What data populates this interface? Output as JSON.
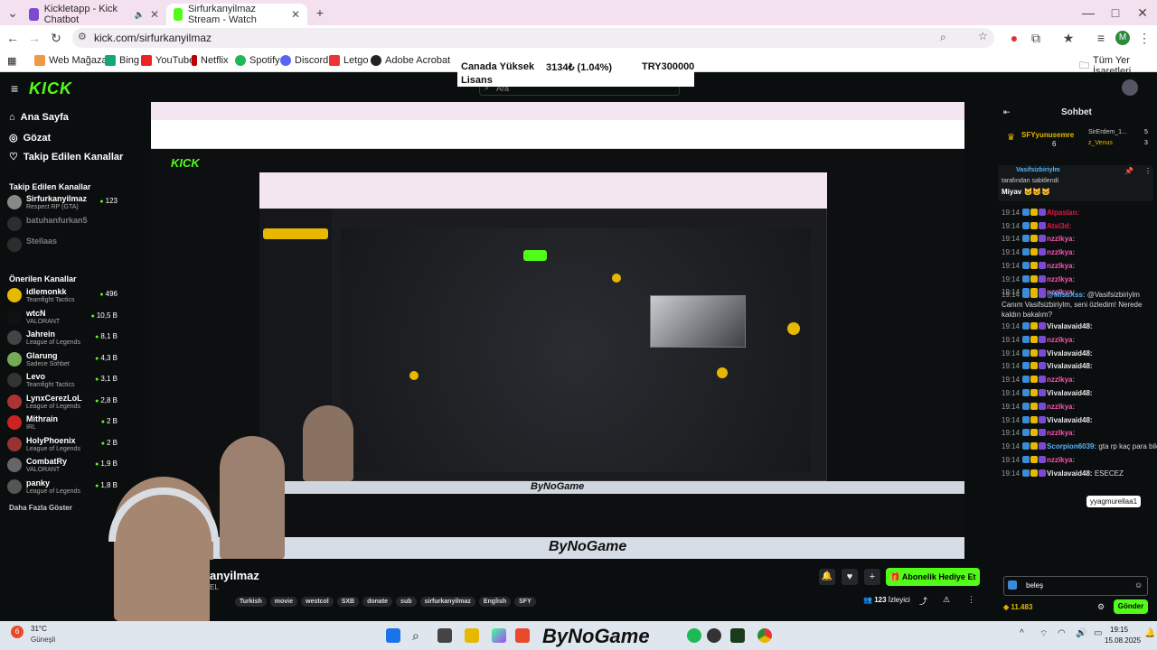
{
  "browser": {
    "tabs": [
      {
        "title": "Kickletapp - Kick Chatbot"
      },
      {
        "title": "Sirfurkanyilmaz Stream - Watch"
      }
    ],
    "url": "kick.com/sirfurkanyilmaz",
    "bookmarks": [
      "Web Mağazası",
      "Bing",
      "YouTube",
      "Netflix",
      "Spotify",
      "Discord",
      "Letgo",
      "Adobe Acrobat"
    ],
    "all_bookmarks": "Tüm Yer İşaretleri",
    "avatar_letter": "M"
  },
  "ticker": {
    "label1": "Canada Yüksek",
    "label2": "Lisans",
    "value": "3134₺ (1.04%)",
    "try": "TRY300000"
  },
  "kick": {
    "search_placeholder": "Ara",
    "nav": [
      "Ana Sayfa",
      "Gözat",
      "Takip Edilen Kanallar"
    ],
    "followed_head": "Takip Edilen Kanallar",
    "followed": [
      {
        "name": "Sirfurkanyilmaz",
        "game": "Respect RP (GTA)",
        "viewers": "123",
        "color": "#888"
      },
      {
        "name": "batuhanfurkan5",
        "game": "",
        "viewers": "",
        "color": "#555"
      },
      {
        "name": "Stellaas",
        "game": "",
        "viewers": "",
        "color": "#555"
      }
    ],
    "recommended_head": "Önerilen Kanallar",
    "recommended": [
      {
        "name": "idlemonkk",
        "game": "Teamfight Tactics",
        "viewers": "496",
        "color": "#e6b800"
      },
      {
        "name": "wtcN",
        "game": "VALORANT",
        "viewers": "10,5 B",
        "color": "#111"
      },
      {
        "name": "Jahrein",
        "game": "League of Legends",
        "viewers": "8,1 B",
        "color": "#444"
      },
      {
        "name": "Glarung",
        "game": "Sadece Sohbet",
        "viewers": "4,3 B",
        "color": "#7a5"
      },
      {
        "name": "Levo",
        "game": "Teamfight Tactics",
        "viewers": "3,1 B",
        "color": "#333"
      },
      {
        "name": "LynxCerezLoL",
        "game": "League of Legends",
        "viewers": "2,8 B",
        "color": "#a33"
      },
      {
        "name": "Mithrain",
        "game": "IRL",
        "viewers": "2 B",
        "color": "#c22"
      },
      {
        "name": "HolyPhoenix",
        "game": "League of Legends",
        "viewers": "2 B",
        "color": "#933"
      },
      {
        "name": "CombatRy",
        "game": "VALORANT",
        "viewers": "1,9 B",
        "color": "#666"
      },
      {
        "name": "panky",
        "game": "League of Legends",
        "viewers": "1,8 B",
        "color": "#555"
      }
    ],
    "show_more": "Daha Fazla Göster"
  },
  "stream": {
    "name": "anyilmaz",
    "sub": "EL",
    "tags": [
      "Turkish",
      "movie",
      "westcol",
      "SXB",
      "donate",
      "sub",
      "sirfurkanyilmaz",
      "English",
      "SFY"
    ],
    "viewers": "123",
    "viewers_label": "İzleyici",
    "gift_button": "Abonelik Hediye Et",
    "watermark": "ByNoGame"
  },
  "chat": {
    "title": "Sohbet",
    "top_users": [
      {
        "name": "SFYyunusemre",
        "value": "6"
      },
      {
        "name": "SirErdem_1...",
        "value": "5"
      },
      {
        "name": "z_Venus",
        "value": "3"
      }
    ],
    "pinned_by": "Vasifsizbiriylm",
    "pinned_label": "tarafından sabitlendi",
    "pinned_msg": "Miyav 🐱🐱🐱",
    "messages": [
      {
        "time": "19:14",
        "user": "Alpaslan:",
        "text": "",
        "color": "#e14"
      },
      {
        "time": "19:14",
        "user": "Atsl3d:",
        "text": "",
        "color": "#e14"
      },
      {
        "time": "19:14",
        "user": "nzzlkya:",
        "text": "",
        "color": "#ff4fb2"
      },
      {
        "time": "19:14",
        "user": "nzzlkya:",
        "text": "",
        "color": "#ff4fb2"
      },
      {
        "time": "19:14",
        "user": "nzzlkya:",
        "text": "",
        "color": "#ff4fb2"
      },
      {
        "time": "19:14",
        "user": "nzzlkya:",
        "text": "",
        "color": "#ff4fb2"
      },
      {
        "time": "19:14",
        "user": "nzzlkya:",
        "text": "",
        "color": "#ff4fb2"
      },
      {
        "time": "19:14",
        "user": "@MissXss:",
        "text": "@Vasifsizbiriylm Canım Vasifsizbiriylm, seni özledim! Nerede kaldın bakalım?",
        "color": "#53b4ff"
      },
      {
        "time": "19:14",
        "user": "Vivalavaid48:",
        "text": "",
        "color": "#e8e8e8"
      },
      {
        "time": "19:14",
        "user": "nzzlkya:",
        "text": "",
        "color": "#ff4fb2"
      },
      {
        "time": "19:14",
        "user": "Vivalavaid48:",
        "text": "",
        "color": "#e8e8e8"
      },
      {
        "time": "19:14",
        "user": "Vivalavaid48:",
        "text": "",
        "color": "#e8e8e8"
      },
      {
        "time": "19:14",
        "user": "nzzlkya:",
        "text": "",
        "color": "#ff4fb2"
      },
      {
        "time": "19:14",
        "user": "Vivalavaid48:",
        "text": "",
        "color": "#e8e8e8"
      },
      {
        "time": "19:14",
        "user": "nzzlkya:",
        "text": "",
        "color": "#ff4fb2"
      },
      {
        "time": "19:14",
        "user": "Vivalavaid48:",
        "text": "",
        "color": "#e8e8e8"
      },
      {
        "time": "19:14",
        "user": "nzzlkya:",
        "text": "",
        "color": "#ff4fb2"
      },
      {
        "time": "19:14",
        "user": "Scorpion6039:",
        "text": "gta rp kaç para bilen varmı",
        "color": "#53b4ff"
      },
      {
        "time": "19:14",
        "user": "nzzlkya:",
        "text": "",
        "color": "#ff4fb2"
      },
      {
        "time": "19:14",
        "user": "Vivalavaid48:",
        "text": "ESECEZ",
        "color": "#e8e8e8"
      }
    ],
    "tooltip": "yyagmurellaa1",
    "input_value": "beleş",
    "points": "11.483",
    "send": "Gönder"
  },
  "taskbar": {
    "weather_temp": "31°C",
    "weather_label": "Güneşli",
    "time": "19:15",
    "date": "15.08.2025",
    "badge": "6"
  }
}
